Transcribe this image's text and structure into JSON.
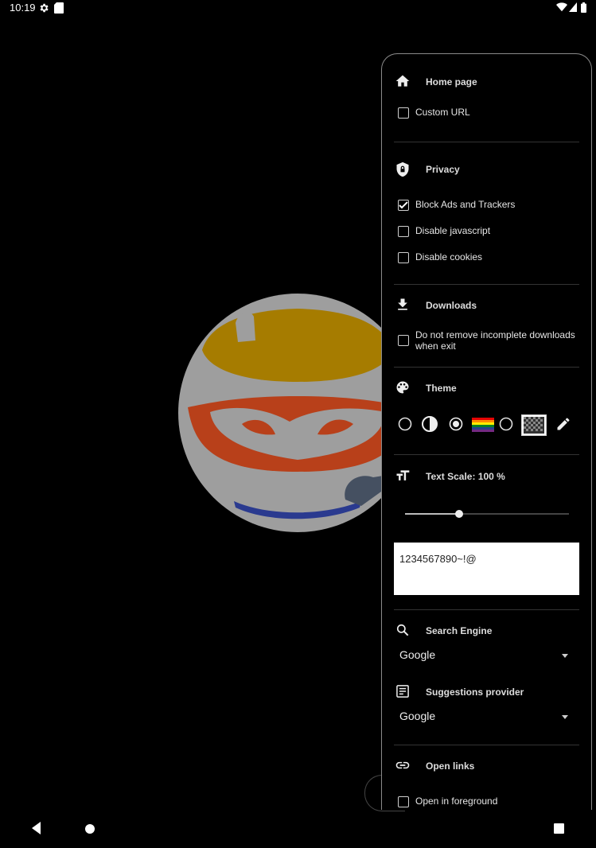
{
  "status_bar": {
    "time": "10:19"
  },
  "menu": {
    "home_page": {
      "title": "Home page",
      "custom_url": {
        "label": "Custom URL",
        "checked": false
      }
    },
    "privacy": {
      "title": "Privacy",
      "options": [
        {
          "label": "Block Ads and Trackers",
          "checked": true
        },
        {
          "label": "Disable javascript",
          "checked": false
        },
        {
          "label": "Disable cookies",
          "checked": false
        }
      ]
    },
    "downloads": {
      "title": "Downloads",
      "keep_incomplete": {
        "label": "Do not remove incomplete downloads when exit",
        "checked": false
      }
    },
    "theme": {
      "title": "Theme",
      "selected_index": 2
    },
    "text_scale": {
      "title": "Text Scale: 100 %",
      "level": 0.33,
      "sample_text": "1234567890~!@"
    },
    "search_engine": {
      "title": "Search Engine",
      "value": "Google"
    },
    "suggestions": {
      "title": "Suggestions provider",
      "value": "Google"
    },
    "open_links": {
      "title": "Open links",
      "foreground": {
        "label": "Open in foreground",
        "checked": false
      }
    }
  },
  "colors": {
    "panel_border": "#8a8a8a",
    "mascot_gold": "#a67c00",
    "mascot_red": "#b8401a",
    "mascot_blue": "#2a3a8f"
  }
}
